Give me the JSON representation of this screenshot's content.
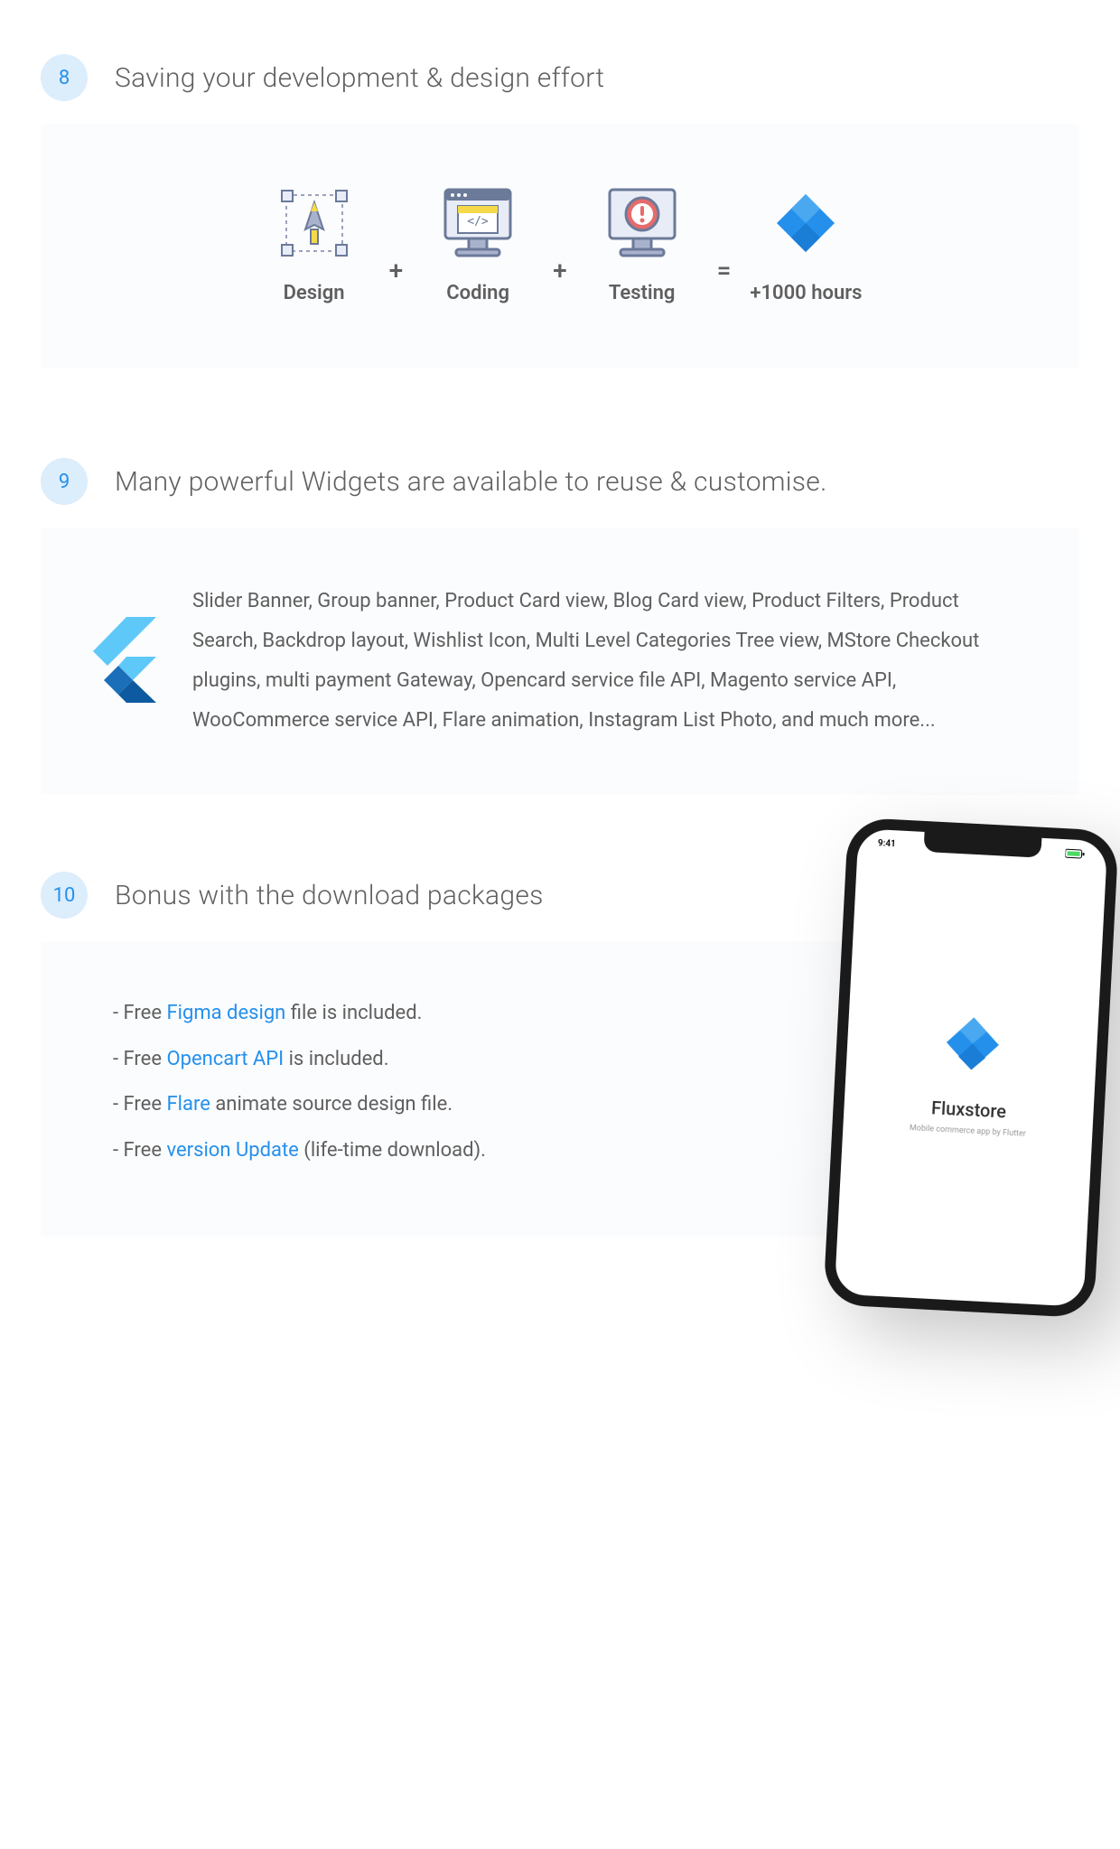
{
  "section8": {
    "number": "8",
    "title": "Saving your development & design effort",
    "items": [
      "Design",
      "Coding",
      "Testing"
    ],
    "result": "+1000 hours",
    "ops": [
      "+",
      "+",
      "="
    ]
  },
  "section9": {
    "number": "9",
    "title": "Many powerful Widgets are available to reuse & customise.",
    "body": "Slider Banner, Group banner, Product Card view, Blog Card view, Product Filters, Product Search, Backdrop layout, Wishlist Icon, Multi Level  Categories Tree view, MStore Checkout plugins, multi payment Gateway, Opencard service file API, Magento service API, WooCommerce service API, Flare animation, Instagram List Photo, and much more..."
  },
  "section10": {
    "number": "10",
    "title": "Bonus with the download packages",
    "lines": [
      {
        "prefix": "- Free ",
        "link": "Figma design",
        "suffix": " file is included."
      },
      {
        "prefix": "- Free ",
        "link": "Opencart API",
        "suffix": " is included."
      },
      {
        "prefix": "- Free ",
        "link": "Flare",
        "suffix": " animate source design file."
      },
      {
        "prefix": "- Free ",
        "link": "version Update",
        "suffix": " (life-time download)."
      }
    ],
    "phone": {
      "time": "9:41",
      "title": "Fluxstore",
      "subtitle": "Mobile commerce app by Flutter"
    }
  }
}
